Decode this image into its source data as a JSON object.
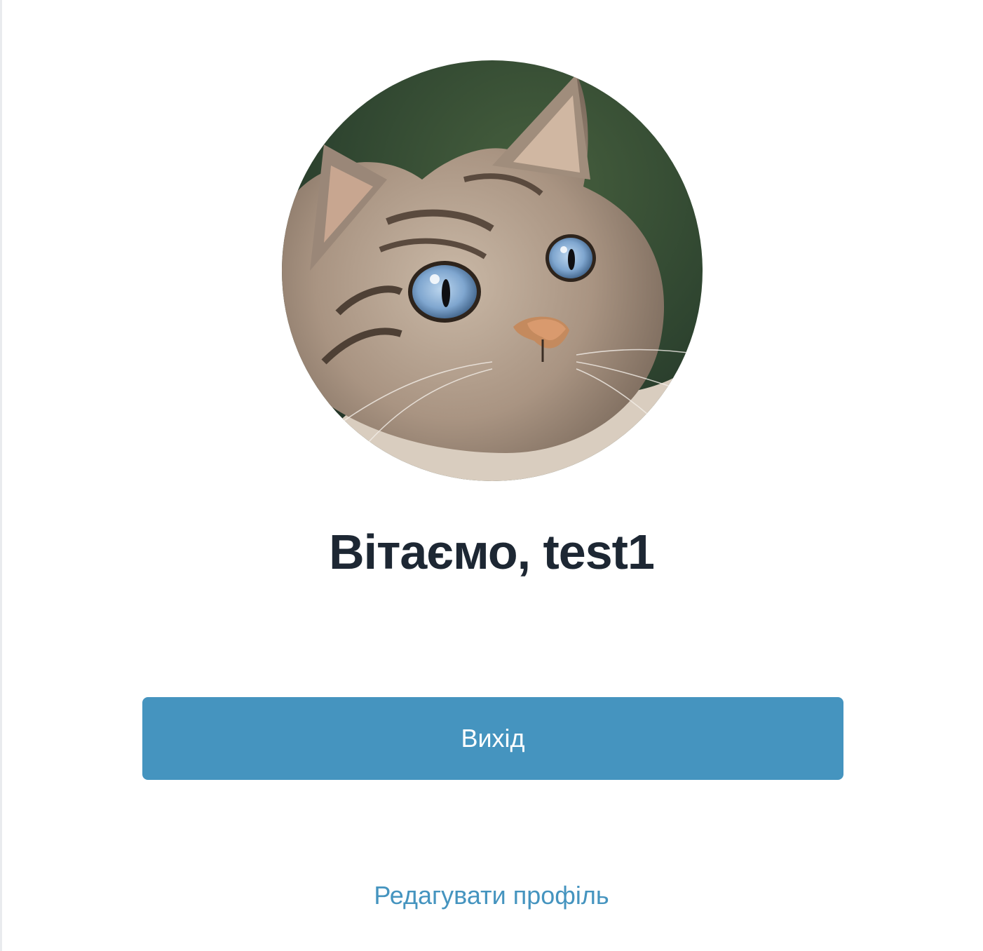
{
  "profile": {
    "avatar_icon": "cat-photo",
    "greeting": "Вітаємо, test1"
  },
  "actions": {
    "logout_label": "Вихід",
    "edit_profile_label": "Редагувати профіль"
  },
  "colors": {
    "accent": "#4594bf",
    "title_text": "#1d2733",
    "button_text": "#ffffff"
  }
}
